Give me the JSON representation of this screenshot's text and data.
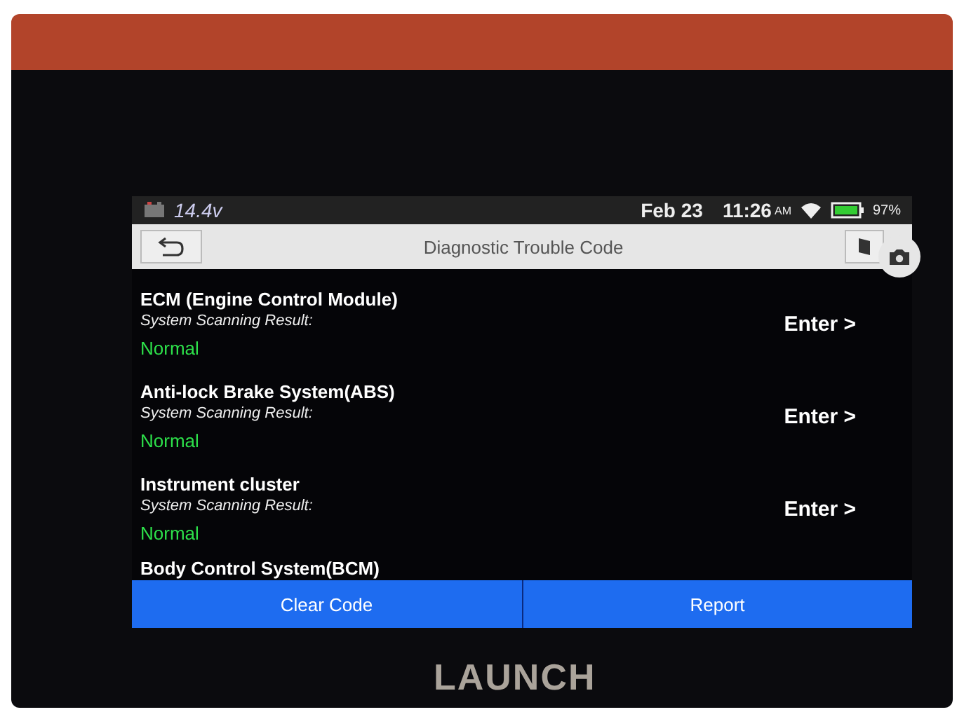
{
  "status_bar": {
    "voltage": "14.4v",
    "date": "Feb 23",
    "time": "11:26",
    "ampm": "AM",
    "battery": "97%"
  },
  "title_bar": {
    "title": "Diagnostic Trouble Code"
  },
  "systems": [
    {
      "name": "ECM (Engine Control Module)",
      "label": "System Scanning Result:",
      "result": "Normal",
      "action": "Enter >"
    },
    {
      "name": "Anti-lock Brake System(ABS)",
      "label": "System Scanning Result:",
      "result": "Normal",
      "action": "Enter >"
    },
    {
      "name": "Instrument cluster",
      "label": "System Scanning Result:",
      "result": "Normal",
      "action": "Enter >"
    },
    {
      "name": "Body Control System(BCM)"
    }
  ],
  "buttons": [
    "Clear Code",
    "Report"
  ],
  "device_logo": "LAUNCH"
}
